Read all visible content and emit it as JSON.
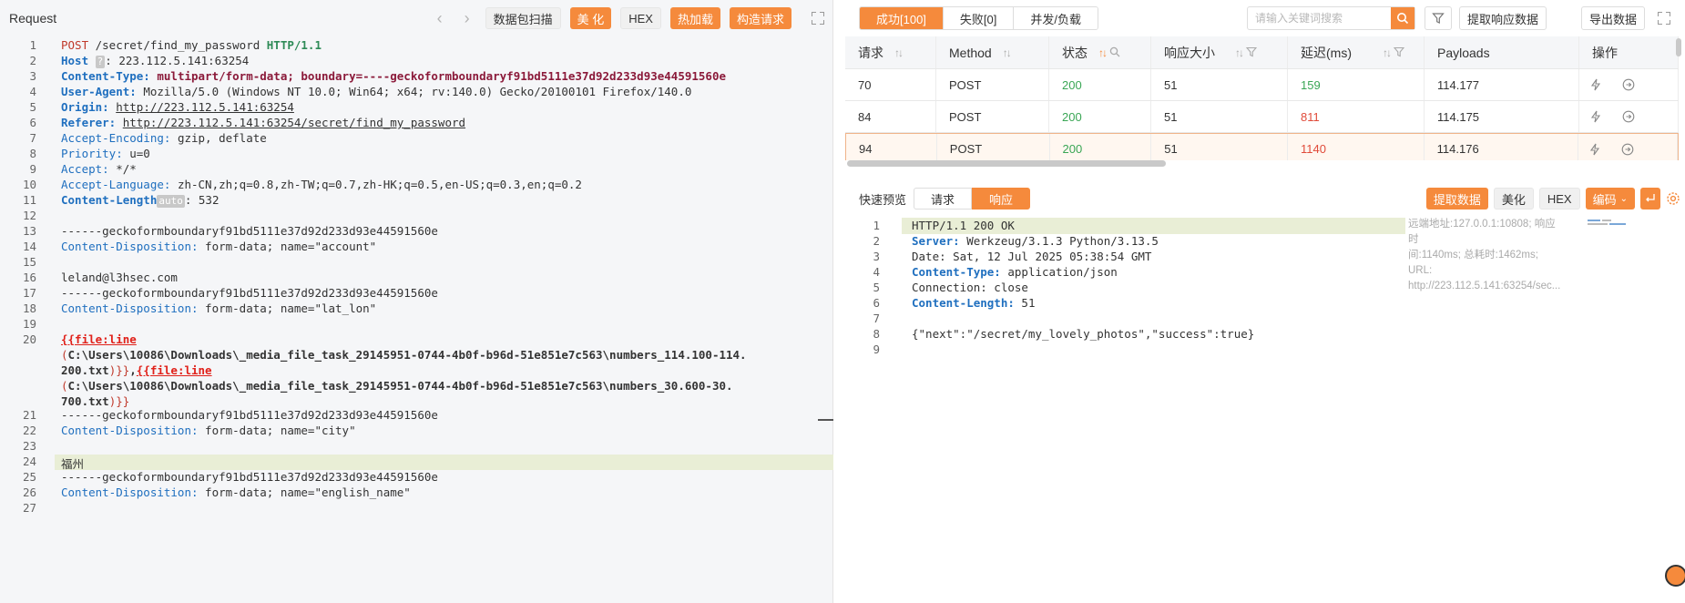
{
  "left": {
    "title": "Request",
    "prev_label": "‹",
    "next_label": "›",
    "buttons": {
      "scan": "数据包扫描",
      "beautify": "美 化",
      "hex": "HEX",
      "hot_load": "热加载",
      "build_request": "构造请求"
    },
    "badge_q": "?",
    "badge_auto": "auto",
    "lines": {
      "l1_method": "POST",
      "l1_path": " /secret/find_my_password ",
      "l1_proto": "HTTP/1.1",
      "l2_key": "Host",
      "l2_val": ": 223.112.5.141:63254",
      "l3_key": "Content-Type:",
      "l3_val": " multipart/form-data; boundary=----geckoformboundaryf91bd5111e37d92d233d93e44591560e",
      "l4_key": "User-Agent:",
      "l4_val": " Mozilla/5.0 (Windows NT 10.0; Win64; x64; rv:140.0) Gecko/20100101 Firefox/140.0",
      "l5_key": "Origin:",
      "l5_val": "http://223.112.5.141:63254",
      "l6_key": "Referer:",
      "l6_val": "http://223.112.5.141:63254/secret/find_my_password",
      "l7_key": "Accept-Encoding:",
      "l7_val": " gzip, deflate",
      "l8_key": "Priority:",
      "l8_val": " u=0",
      "l9_key": "Accept:",
      "l9_val": " */*",
      "l10_key": "Accept-Language:",
      "l10_val": " zh-CN,zh;q=0.8,zh-TW;q=0.7,zh-HK;q=0.5,en-US;q=0.3,en;q=0.2",
      "l11_key": "Content-Length",
      "l11_val": ": 532",
      "boundary": "------geckoformboundaryf91bd5111e37d92d233d93e44591560e",
      "cd_key": "Content-Disposition:",
      "cd_account": " form-data; name=\"account\"",
      "email": "leland@l3hsec.com",
      "cd_latlon": " form-data; name=\"lat_lon\"",
      "l20_fn1": "{{file:line",
      "l20_path1_open": "(",
      "l20_path1": "C:\\Users\\10086\\Downloads\\_media_file_task_29145951-0744-4b0f-b96d-51e851e7c563\\numbers_114.100-114.",
      "l20_path1_tail": "200.txt",
      "l20_close1": ")}}",
      "l20_comma": ",",
      "l20_fn2": "{{file:line",
      "l20_path2_open": "(",
      "l20_path2": "C:\\Users\\10086\\Downloads\\_media_file_task_29145951-0744-4b0f-b96d-51e851e7c563\\numbers_30.600-30.",
      "l20_path2_tail": "700.txt",
      "l20_close2": ")}}",
      "cd_city": " form-data; name=\"city\"",
      "city": "福州",
      "cd_english": " form-data; name=\"english_name\""
    },
    "line_numbers": [
      "1",
      "2",
      "3",
      "4",
      "5",
      "6",
      "7",
      "8",
      "9",
      "10",
      "11",
      "12",
      "13",
      "14",
      "15",
      "16",
      "17",
      "18",
      "19",
      "20",
      "21",
      "22",
      "23",
      "24",
      "25",
      "26",
      "27"
    ]
  },
  "right": {
    "tabs": [
      "成功[100]",
      "失败[0]",
      "并发/负载"
    ],
    "search_placeholder": "请输入关键词搜索",
    "extract_response_button": "提取响应数据",
    "export_button": "导出数据",
    "columns": [
      "请求",
      "Method",
      "状态",
      "响应大小",
      "延迟(ms)",
      "Payloads",
      "操作"
    ],
    "rows": [
      {
        "id": "70",
        "method": "POST",
        "status": "200",
        "size": "51",
        "latency": "159",
        "payload": "114.177"
      },
      {
        "id": "84",
        "method": "POST",
        "status": "200",
        "size": "51",
        "latency": "811",
        "payload": "114.175"
      },
      {
        "id": "94",
        "method": "POST",
        "status": "200",
        "size": "51",
        "latency": "1140",
        "payload": "114.176"
      }
    ],
    "preview_label": "快速预览",
    "preview_tabs": [
      "请求",
      "响应"
    ],
    "preview_buttons": {
      "extract": "提取数据",
      "beautify": "美化",
      "hex": "HEX",
      "encode": "编码"
    },
    "response_lines": {
      "r1": "HTTP/1.1 200 OK",
      "r2_key": "Server:",
      "r2_val": " Werkzeug/3.1.3 Python/3.13.5",
      "r3": "Date: Sat, 12 Jul 2025 05:38:54 GMT",
      "r4_key": "Content-Type:",
      "r4_val": " application/json",
      "r5": "Connection: close",
      "r6_key": "Content-Length:",
      "r6_val": " 51",
      "r8": "{\"next\":\"/secret/my_lovely_photos\",\"success\":true}"
    },
    "response_line_numbers": [
      "1",
      "2",
      "3",
      "4",
      "5",
      "6",
      "7",
      "8",
      "9"
    ],
    "meta": {
      "line1": "远端地址:127.0.0.1:10808; 响应时",
      "line2": "间:1140ms; 总耗时:1462ms; URL:",
      "line3": "http://223.112.5.141:63254/sec..."
    }
  },
  "colors": {
    "accent": "#f58a3c",
    "status_ok": "#3aa655",
    "latency_slow": "#e04b3a"
  }
}
